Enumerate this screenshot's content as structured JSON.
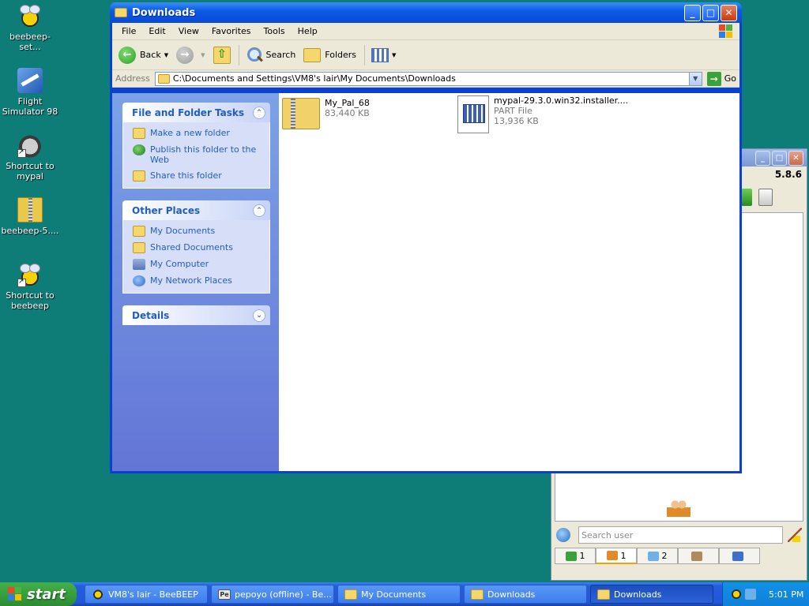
{
  "desktop": {
    "icons": [
      {
        "label": "beebeep-set...",
        "icon": "beebeep-icon"
      },
      {
        "label": "Flight Simulator 98",
        "icon": "flight-simulator-icon"
      },
      {
        "label": "Shortcut to mypal",
        "icon": "mypal-icon"
      },
      {
        "label": "beebeep-5....",
        "icon": "zip-archive-icon"
      },
      {
        "label": "Shortcut to beebeep",
        "icon": "beebeep-icon"
      }
    ]
  },
  "window": {
    "title": "Downloads",
    "menu": [
      "File",
      "Edit",
      "View",
      "Favorites",
      "Tools",
      "Help"
    ],
    "toolbar": {
      "back": "Back",
      "search": "Search",
      "folders": "Folders"
    },
    "address": {
      "label": "Address",
      "path": "C:\\Documents and Settings\\VM8's lair\\My Documents\\Downloads",
      "go": "Go"
    },
    "tasks": {
      "file_folder": {
        "title": "File and Folder Tasks",
        "items": [
          "Make a new folder",
          "Publish this folder to the Web",
          "Share this folder"
        ]
      },
      "other_places": {
        "title": "Other Places",
        "items": [
          "My Documents",
          "Shared Documents",
          "My Computer",
          "My Network Places"
        ]
      },
      "details": {
        "title": "Details"
      }
    },
    "files": [
      {
        "name": "My_Pal_68",
        "type": "",
        "size": "83,440 KB"
      },
      {
        "name": "mypal-29.3.0.win32.installer....",
        "type": "PART File",
        "size": "13,936 KB"
      }
    ]
  },
  "beebeep": {
    "version": "5.8.6",
    "search_placeholder": "Search user",
    "tabs": [
      {
        "count": "1"
      },
      {
        "count": "1"
      },
      {
        "count": "2"
      },
      {
        "count": ""
      },
      {
        "count": ""
      }
    ]
  },
  "taskbar": {
    "start": "start",
    "items": [
      {
        "label": "VM8's lair - BeeBEEP",
        "icon": "beebeep-icon"
      },
      {
        "label": "pepoyo (offline) - Be...",
        "icon": "pe-icon"
      },
      {
        "label": "My Documents",
        "icon": "folder-icon"
      },
      {
        "label": "Downloads",
        "icon": "folder-icon"
      },
      {
        "label": "Downloads",
        "icon": "folder-icon"
      }
    ],
    "clock": "5:01 PM"
  },
  "colors": {
    "desktop": "#0e7d78",
    "title_blue": "#0a5ce5",
    "task_link": "#215dc6"
  }
}
